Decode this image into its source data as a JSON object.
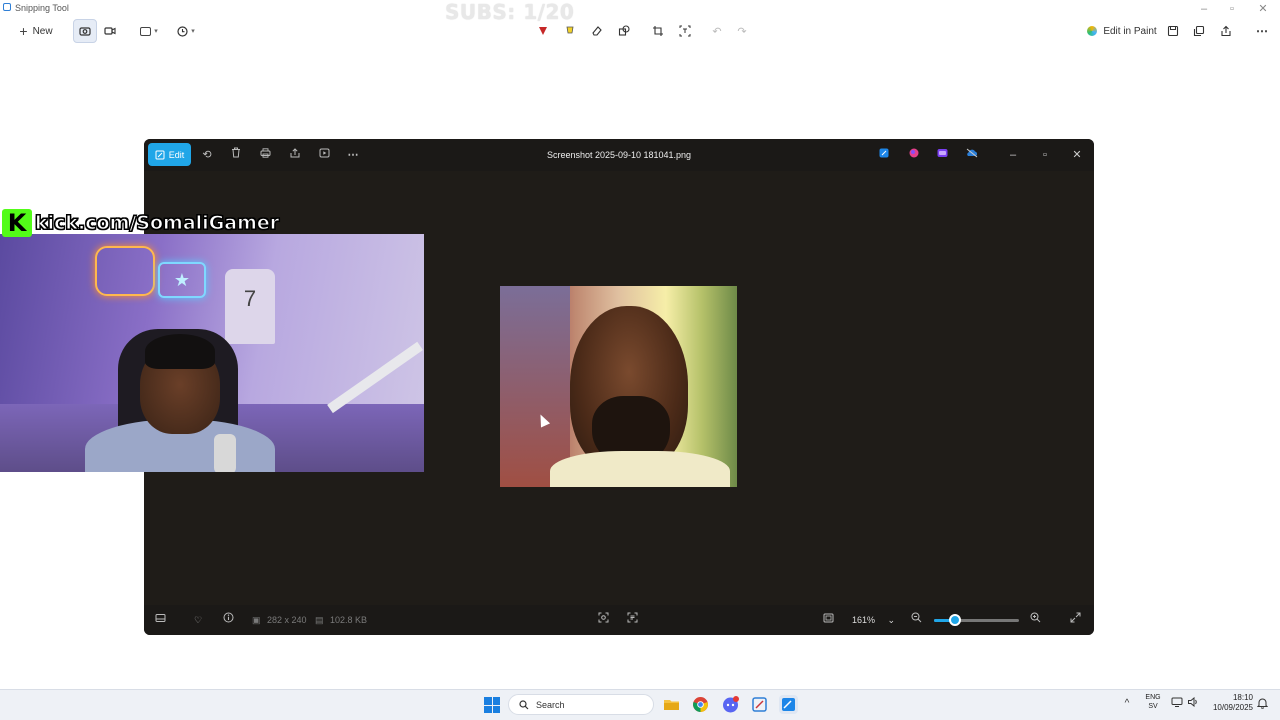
{
  "snipping_tool": {
    "title": "Snipping Tool",
    "new_label": "New",
    "edit_in_paint_label": "Edit in Paint"
  },
  "stream_overlay": {
    "subs_text": "SUBS: 1/20",
    "kick_logo": "K",
    "kick_url": "kick.com/SomaliGamer"
  },
  "photos_viewer": {
    "edit_label": "Edit",
    "file_name": "Screenshot 2025-09-10 181041.png",
    "image_dimensions": "282 x 240",
    "file_size": "102.8 KB",
    "zoom_level": "161%",
    "zoom_slider_fraction": 0.25
  },
  "taskbar": {
    "search_placeholder": "Search",
    "language_top": "ENG",
    "language_bottom": "SV",
    "time": "18:10",
    "date": "10/09/2025"
  },
  "colors": {
    "accent": "#20a6e8",
    "kick_green": "#53fc18",
    "viewer_bg": "#1f1c18"
  }
}
